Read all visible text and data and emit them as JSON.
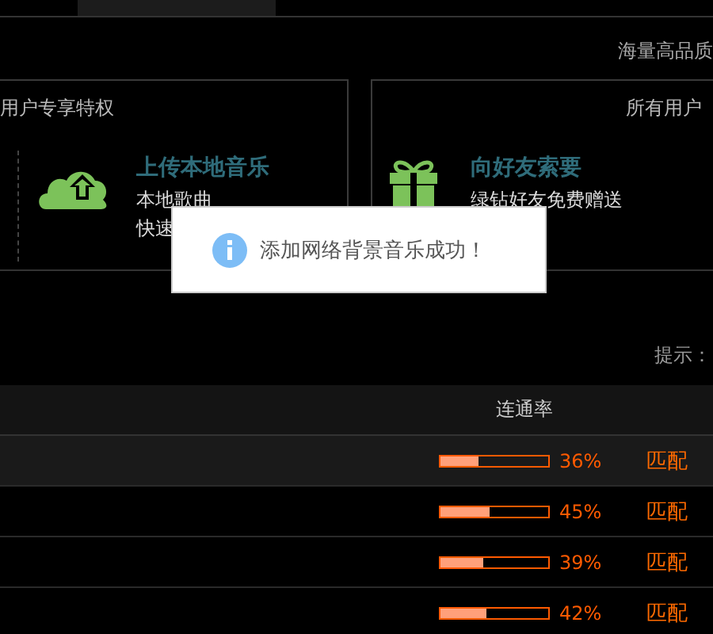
{
  "notice": "海量高品质",
  "cards": [
    {
      "heading": "用户专享特权",
      "kind": "upload",
      "title": "上传本地音乐",
      "lines": [
        "本地歌曲",
        "快速"
      ]
    },
    {
      "heading": "所有用户",
      "kind": "gift",
      "title": "向好友索要",
      "lines": [
        "绿钻好友免费赠送"
      ]
    }
  ],
  "toast": {
    "message": "添加网络背景音乐成功！"
  },
  "hint": "提示：",
  "table": {
    "columns": [
      "连通率"
    ],
    "rows": [
      {
        "level": 0.36,
        "reading": "36%",
        "status": "匹配",
        "selected": true
      },
      {
        "level": 0.45,
        "reading": "45%",
        "status": "匹配",
        "selected": false
      },
      {
        "level": 0.39,
        "reading": "39%",
        "status": "匹配",
        "selected": false
      },
      {
        "level": 0.42,
        "reading": "42%",
        "status": "匹配",
        "selected": false
      }
    ]
  }
}
